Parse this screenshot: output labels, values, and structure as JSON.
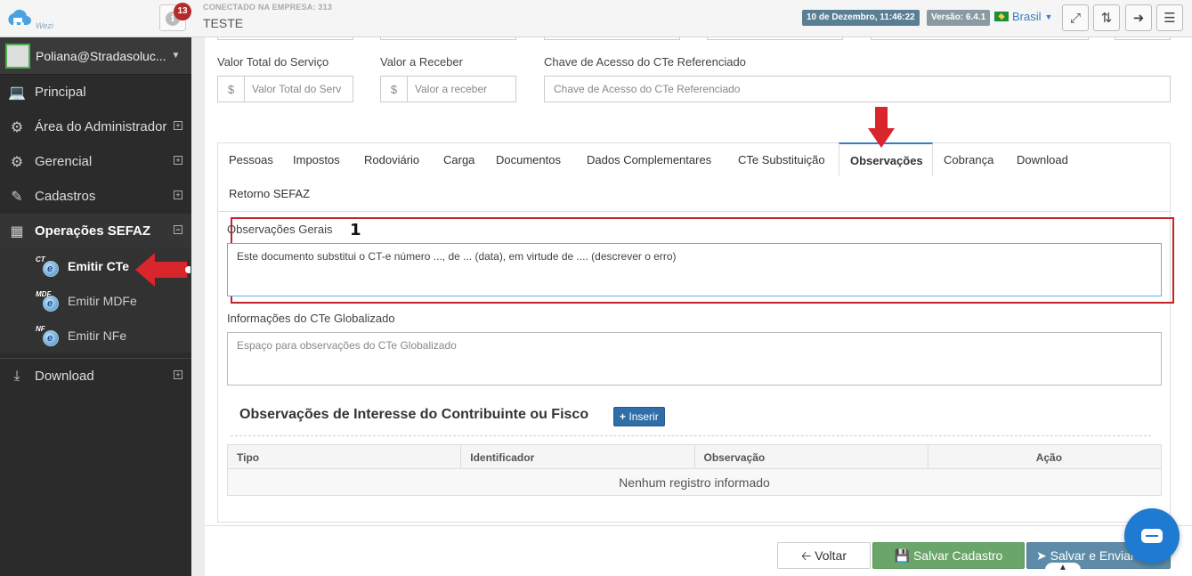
{
  "app": {
    "logo_text": "Wezi"
  },
  "header": {
    "notifications_count": "13",
    "company_label": "CONECTADO NA EMPRESA: 313",
    "company_name": "TESTE",
    "datetime": "10 de Dezembro, 11:46:22",
    "version": "Versão: 6.4.1",
    "language": "Brasil"
  },
  "sidebar": {
    "user": "Poliana@Stradasoluc...",
    "items": [
      {
        "label": "Principal",
        "icon": "laptop-icon"
      },
      {
        "label": "Área do Administrador",
        "icon": "gears-icon"
      },
      {
        "label": "Gerencial",
        "icon": "gears-icon"
      },
      {
        "label": "Cadastros",
        "icon": "edit-icon"
      },
      {
        "label": "Operações SEFAZ",
        "icon": "windows-icon"
      },
      {
        "label": "Download",
        "icon": "download-icon"
      }
    ],
    "subitems": [
      {
        "label": "Emitir CTe",
        "abbr": "CT"
      },
      {
        "label": "Emitir MDFe",
        "abbr": "MDF"
      },
      {
        "label": "Emitir NFe",
        "abbr": "NF"
      }
    ]
  },
  "form": {
    "valor_total_label": "Valor Total do Serviço",
    "valor_total_placeholder": "Valor Total do Serv",
    "valor_receber_label": "Valor a Receber",
    "valor_receber_placeholder": "Valor a receber",
    "chave_label": "Chave de Acesso do CTe Referenciado",
    "chave_placeholder": "Chave de Acesso do CTe Referenciado",
    "currency_symbol": "$"
  },
  "tabs": [
    "Pessoas",
    "Impostos",
    "Rodoviário",
    "Carga",
    "Documentos",
    "Dados Complementares",
    "CTe Substituição",
    "Observações",
    "Cobrança",
    "Download",
    "Retorno SEFAZ"
  ],
  "observacoes": {
    "step_number": "1",
    "gerais_label": "Observações Gerais",
    "gerais_value": "Este documento substitui o CT-e número ..., de ... (data), em virtude de .... (descrever o erro)",
    "globalizado_label": "Informações do CTe Globalizado",
    "globalizado_placeholder": "Espaço para observações do CTe Globalizado",
    "section_title": "Observações de Interesse do Contribuinte ou Fisco",
    "inserir_label": "Inserir",
    "table_headers": [
      "Tipo",
      "Identificador",
      "Observação",
      "Ação"
    ],
    "empty_message": "Nenhum registro informado"
  },
  "footer": {
    "voltar": "Voltar",
    "salvar": "Salvar Cadastro",
    "enviar": "Salvar e Enviar"
  },
  "colors": {
    "annotation_red": "#c4232b",
    "sidebar_bg": "#2b2b2b",
    "primary_blue": "#2f6ea7"
  }
}
